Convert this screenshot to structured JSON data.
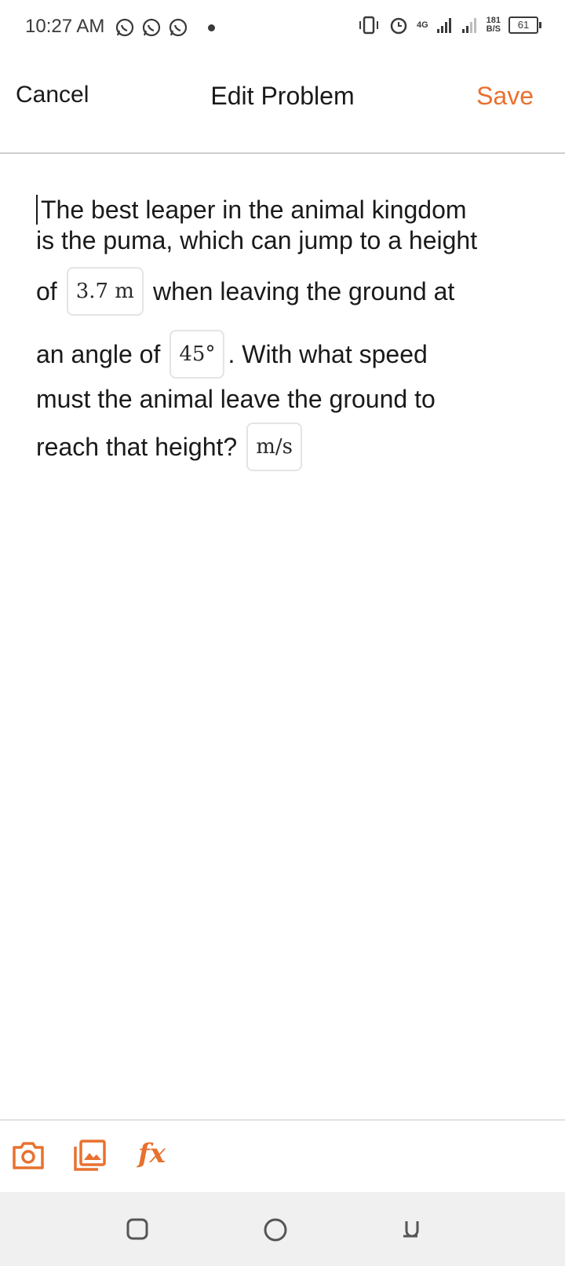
{
  "status_bar": {
    "time": "10:27 AM",
    "net_speed_value": "181",
    "net_speed_unit": "B/S",
    "battery": "61",
    "network": "4G",
    "icons": [
      "whatsapp-icon",
      "whatsapp-icon",
      "whatsapp-icon",
      "vibrate-icon",
      "alarm-icon",
      "signal-icon",
      "signal-icon",
      "battery-icon"
    ]
  },
  "header": {
    "cancel_label": "Cancel",
    "title": "Edit Problem",
    "save_label": "Save"
  },
  "problem": {
    "line1": "The best leaper in the animal kingdom",
    "line2": "is the puma, which can jump to a height",
    "line3_pre": "of",
    "height_value": "3.7 m",
    "line3_post": "when leaving the ground at",
    "line4_pre": "an angle of",
    "angle_value": "45°",
    "line4_post": ". With what speed",
    "line5": "must the animal leave the ground to",
    "line6_pre": "reach that height?",
    "answer_unit": "m/s"
  },
  "toolbar": {
    "icons": [
      "camera-icon",
      "gallery-icon",
      "function-icon"
    ],
    "fx_label": "fx"
  },
  "colors": {
    "accent": "#e8712f",
    "text": "#1a1a1a",
    "nav_background": "#f0f0f0"
  }
}
